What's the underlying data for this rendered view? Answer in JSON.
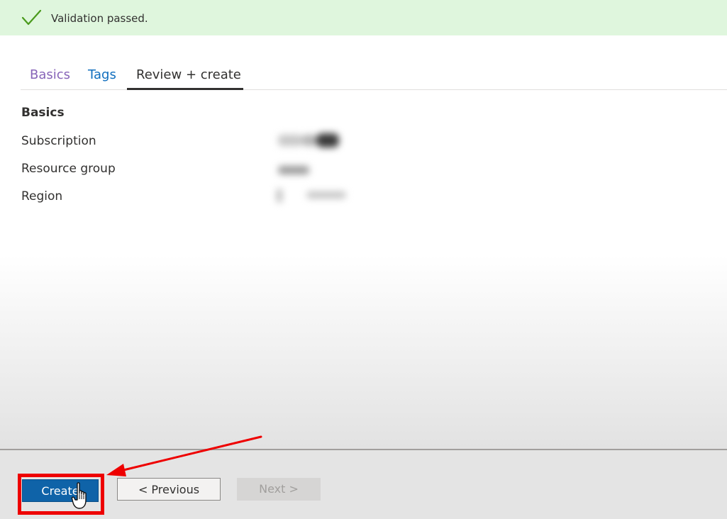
{
  "banner": {
    "message": "Validation passed.",
    "icon": "checkmark-icon",
    "color": "#dff6dd"
  },
  "tabs": [
    {
      "label": "Basics",
      "state": "visited"
    },
    {
      "label": "Tags",
      "state": "link"
    },
    {
      "label": "Review + create",
      "state": "selected"
    }
  ],
  "summary": {
    "section_title": "Basics",
    "rows": [
      {
        "label": "Subscription"
      },
      {
        "label": "Resource group"
      },
      {
        "label": "Region"
      }
    ]
  },
  "footer": {
    "create_label": "Create",
    "previous_label": "< Previous",
    "next_label": "Next >"
  },
  "annotation": {
    "highlight_color": "#ee0000"
  }
}
